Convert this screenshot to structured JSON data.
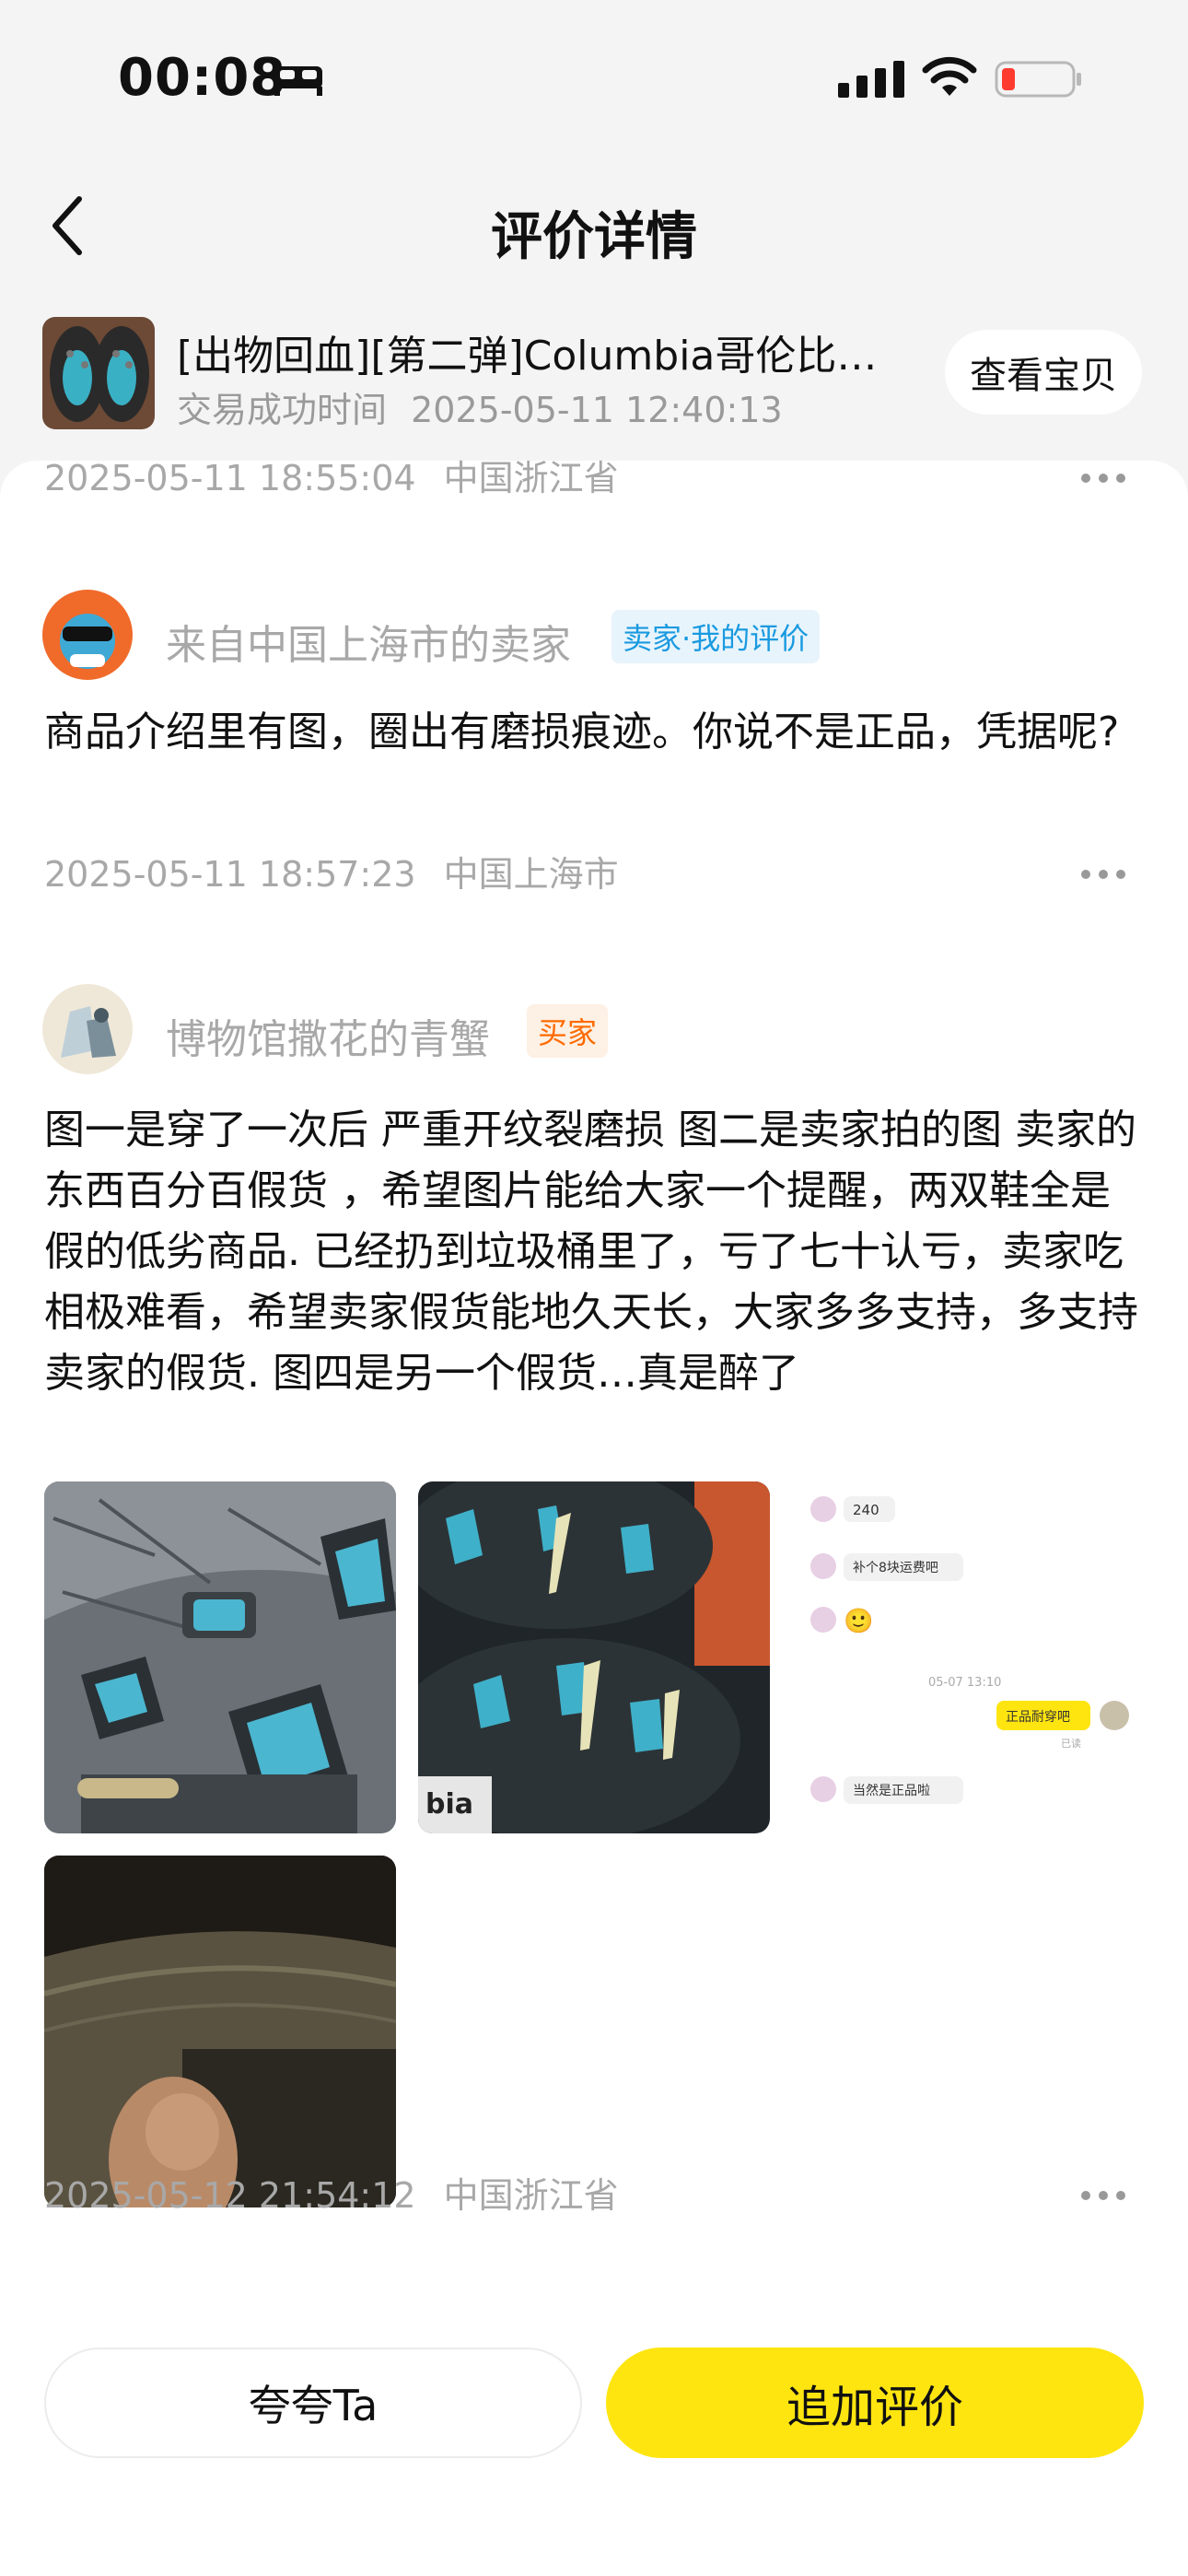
{
  "status_bar": {
    "time": "00:08",
    "icons": [
      "bed-icon",
      "signal-icon",
      "wifi-icon",
      "battery-low-icon"
    ]
  },
  "header": {
    "title": "评价详情",
    "back_icon": "chevron-left-icon"
  },
  "product": {
    "title": "[出物回血][第二弹]Columbia哥伦比…",
    "trade_label": "交易成功时间",
    "trade_time": "2025-05-11 12:40:13",
    "view_button": "查看宝贝"
  },
  "top_meta": {
    "time": "2025-05-11 18:55:04",
    "location": "中国浙江省"
  },
  "seller_reply": {
    "user": "来自中国上海市的卖家",
    "tag": "卖家·我的评价",
    "text": "商品介绍里有图，圈出有磨损痕迹。你说不是正品，凭据呢?",
    "time": "2025-05-11 18:57:23",
    "location": "中国上海市"
  },
  "buyer_review": {
    "user": "博物馆撒花的青蟹",
    "tag": "买家",
    "text": "图一是穿了一次后 严重开纹裂磨损 图二是卖家拍的图 卖家的东西百分百假货 ，希望图片能给大家一个提醒，两双鞋全是假的低劣商品. 已经扔到垃圾桶里了，亏了七十认亏，卖家吃相极难看，希望卖家假货能地久天长，大家多多支持，多支持卖家的假货. 图四是另一个假货…真是醉了",
    "chat_screenshot": {
      "messages": [
        "240",
        "补个8块运费吧",
        "🙂",
        "05-07 13:10",
        "正品耐穿吧",
        "已读",
        "当然是正品啦"
      ]
    },
    "time": "2025-05-12 21:54:12",
    "location": "中国浙江省"
  },
  "actions": {
    "praise": "夸夸Ta",
    "add_review": "追加评价"
  },
  "colors": {
    "accent_yellow": "#ffe510",
    "seller_tag_blue": "#1a9ae0",
    "buyer_tag_orange": "#ff6a00"
  }
}
